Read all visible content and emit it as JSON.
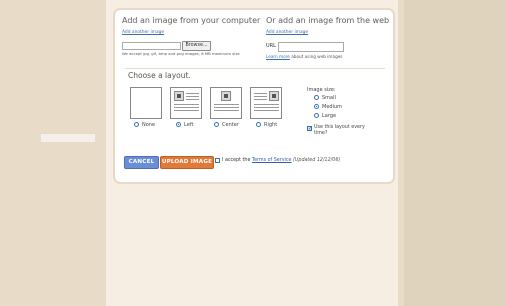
{
  "upload": {
    "title": "Add an image from your computer",
    "add_another": "Add another image",
    "browse_label": "Browse...",
    "note": "We accept jpg, gif, bmp and png images, 8 MB maximum size"
  },
  "web": {
    "title": "Or add an image from the web",
    "add_another": "Add another image",
    "url_label": "URL",
    "url_value": "",
    "learn_more": "Learn more",
    "learn_more_rest": " about using web images"
  },
  "layout": {
    "title": "Choose a layout.",
    "options": [
      {
        "label": "None",
        "selected": false
      },
      {
        "label": "Left",
        "selected": true
      },
      {
        "label": "Center",
        "selected": false
      },
      {
        "label": "Right",
        "selected": false
      }
    ]
  },
  "image_size": {
    "title": "Image size:",
    "options": [
      {
        "label": "Small",
        "selected": false
      },
      {
        "label": "Medium",
        "selected": true
      },
      {
        "label": "Large",
        "selected": false
      }
    ],
    "remember_label": "Use this layout every time?",
    "remember_checked": true
  },
  "actions": {
    "cancel": "CANCEL",
    "upload": "UPLOAD IMAGE",
    "accept_prefix": "I accept the ",
    "tos_link": "Terms of Service",
    "updated": "(Updated 12/12/06)"
  },
  "colors": {
    "cancel": "#6b8fd4",
    "upload": "#e07a3a",
    "link": "#3a6fb0",
    "background": "#e8dcc8"
  }
}
